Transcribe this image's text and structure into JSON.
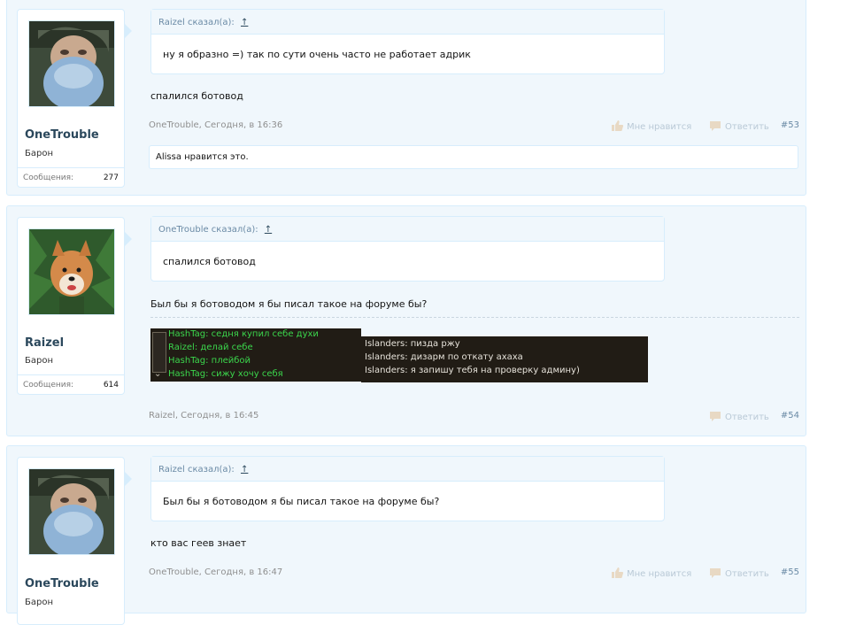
{
  "posts": [
    {
      "id": 53,
      "author": "OneTrouble",
      "rank": "Барон",
      "stats_label": "Сообщения:",
      "stats_count": "277",
      "quote_header": "Raizel сказал(а):",
      "quote_up": "↑",
      "quote_text": "ну я образно =) так по сути очень часто не работает адрик",
      "message": "спалился ботовод",
      "meta_author_time": "OneTrouble, Сегодня, в 16:36",
      "like_label": "Мне нравится",
      "reply_label": "Ответить",
      "number": "#53",
      "likes_text": "Alissa нравится это."
    },
    {
      "id": 54,
      "author": "Raizel",
      "rank": "Барон",
      "stats_label": "Сообщения:",
      "stats_count": "614",
      "quote_header": "OneTrouble сказал(а):",
      "quote_up": "↑",
      "quote_text": "спалился ботовод",
      "message": "Был бы я ботоводом я бы писал такое на форуме бы?",
      "meta_author_time": "Raizel, Сегодня, в 16:45",
      "reply_label": "Ответить",
      "number": "#54",
      "chat_left": [
        "HashTag: седня купил себе духи",
        "Raizel: делай себе",
        "HashTag: плейбой",
        "HashTag: сижу хочу себя"
      ],
      "chat_right": [
        "Islanders: пизда ржу",
        "Islanders: дизарм по откату ахаха",
        "Islanders: я запишу тебя на проверку админу)"
      ]
    },
    {
      "id": 55,
      "author": "OneTrouble",
      "rank": "Барон",
      "quote_header": "Raizel сказал(а):",
      "quote_up": "↑",
      "quote_text": "Был бы я ботоводом я бы писал такое на форуме бы?",
      "message": "кто вас геев знает",
      "meta_author_time": "OneTrouble, Сегодня, в 16:47",
      "like_label": "Мне нравится",
      "reply_label": "Ответить",
      "number": "#55"
    }
  ],
  "colors": {
    "post_bg": "#f0f7fc",
    "border": "#d7edfc",
    "username": "#2b485c",
    "chat_green": "#3bd64c"
  }
}
